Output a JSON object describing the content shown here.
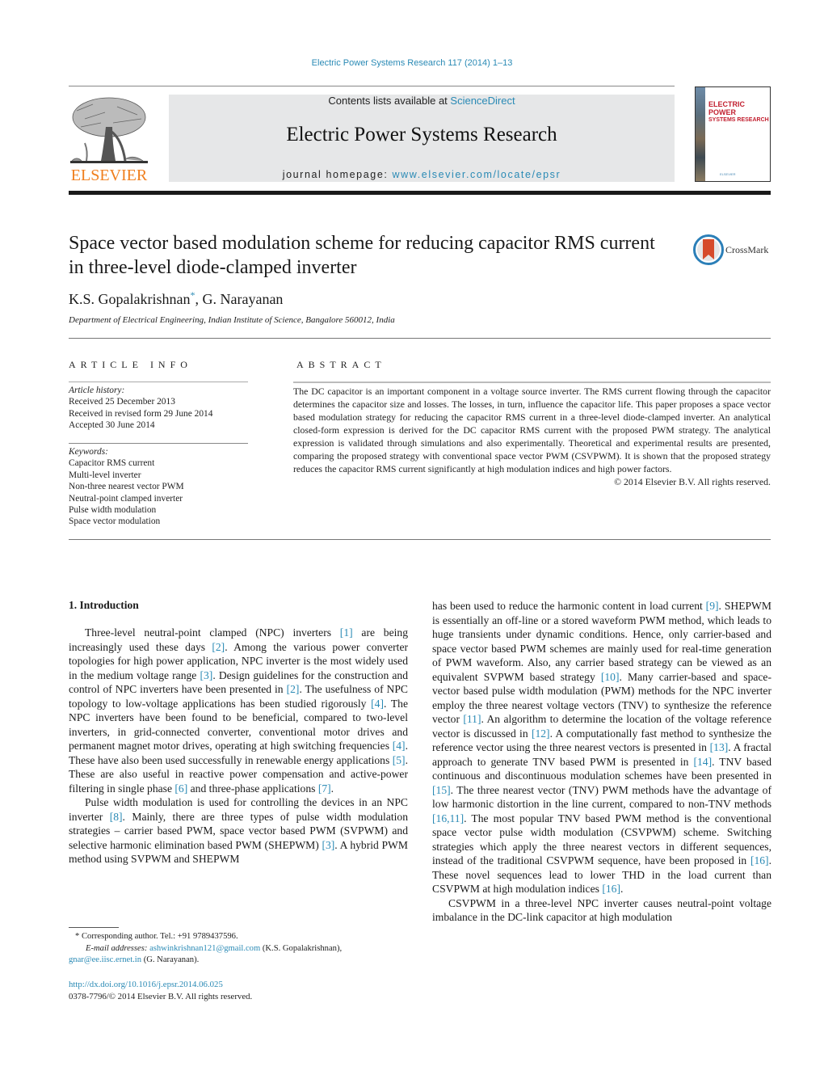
{
  "header": {
    "journal_ref": "Electric Power Systems Research 117 (2014) 1–13",
    "contents_prefix": "Contents lists available at ",
    "contents_link": "ScienceDirect",
    "journal_title": "Electric Power Systems Research",
    "homepage_prefix": "journal homepage: ",
    "homepage_link": "www.elsevier.com/locate/epsr",
    "publisher_wordmark": "ELSEVIER",
    "cover_title_line1": "ELECTRIC POWER",
    "cover_title_line2": "SYSTEMS RESEARCH",
    "cover_publisher": "ELSEVIER",
    "crossmark_label": "CrossMark",
    "colors": {
      "link": "#2a8ab5",
      "elsevier_orange": "#f07f1e",
      "cover_red": "#c21f2f",
      "masthead_bg": "#e6e7e8"
    }
  },
  "article": {
    "title": "Space vector based modulation scheme for reducing capacitor RMS current in three-level diode-clamped inverter",
    "authors": [
      {
        "name": "K.S. Gopalakrishnan",
        "mark": "*"
      },
      {
        "name": "G. Narayanan",
        "mark": ""
      }
    ],
    "author_separator": ", ",
    "affiliation": "Department of Electrical Engineering, Indian Institute of Science, Bangalore 560012, India"
  },
  "article_info": {
    "heading": "ARTICLE INFO",
    "history_label": "Article history:",
    "history": [
      "Received 25 December 2013",
      "Received in revised form 29 June 2014",
      "Accepted 30 June 2014"
    ],
    "keywords_label": "Keywords:",
    "keywords": [
      "Capacitor RMS current",
      "Multi-level inverter",
      "Non-three nearest vector PWM",
      "Neutral-point clamped inverter",
      "Pulse width modulation",
      "Space vector modulation"
    ]
  },
  "abstract": {
    "heading": "ABSTRACT",
    "text": "The DC capacitor is an important component in a voltage source inverter. The RMS current flowing through the capacitor determines the capacitor size and losses. The losses, in turn, influence the capacitor life. This paper proposes a space vector based modulation strategy for reducing the capacitor RMS current in a three-level diode-clamped inverter. An analytical closed-form expression is derived for the DC capacitor RMS current with the proposed PWM strategy. The analytical expression is validated through simulations and also experimentally. Theoretical and experimental results are presented, comparing the proposed strategy with conventional space vector PWM (CSVPWM). It is shown that the proposed strategy reduces the capacitor RMS current significantly at high modulation indices and high power factors.",
    "copyright": "© 2014 Elsevier B.V. All rights reserved."
  },
  "body": {
    "section_heading": "1.  Introduction",
    "p1": [
      {
        "t": "Three-level neutral-point clamped (NPC) inverters "
      },
      {
        "r": "[1]"
      },
      {
        "t": " are being increasingly used these days "
      },
      {
        "r": "[2]"
      },
      {
        "t": ". Among the various power converter topologies for high power application, NPC inverter is the most widely used in the medium voltage range "
      },
      {
        "r": "[3]"
      },
      {
        "t": ". Design guidelines for the construction and control of NPC inverters have been presented in "
      },
      {
        "r": "[2]"
      },
      {
        "t": ". The usefulness of NPC topology to low-voltage applications has been studied rigorously "
      },
      {
        "r": "[4]"
      },
      {
        "t": ". The NPC inverters have been found to be beneficial, compared to two-level inverters, in grid-connected converter, conventional motor drives and permanent magnet motor drives, operating at high switching frequencies "
      },
      {
        "r": "[4]"
      },
      {
        "t": ". These have also been used successfully in renewable energy applications "
      },
      {
        "r": "[5]"
      },
      {
        "t": ". These are also useful in reactive power compensation and active-power filtering in single phase "
      },
      {
        "r": "[6]"
      },
      {
        "t": " and three-phase applications "
      },
      {
        "r": "[7]"
      },
      {
        "t": "."
      }
    ],
    "p2": [
      {
        "t": "Pulse width modulation is used for controlling the devices in an NPC inverter "
      },
      {
        "r": "[8]"
      },
      {
        "t": ". Mainly, there are three types of pulse width modulation strategies – carrier based PWM, space vector based PWM (SVPWM) and selective harmonic elimination based PWM (SHEPWM) "
      },
      {
        "r": "[3]"
      },
      {
        "t": ". A hybrid PWM method using SVPWM and SHEPWM has been used to reduce the harmonic content in load current "
      },
      {
        "r": "[9]"
      },
      {
        "t": ". SHEPWM is essentially an off-line or a stored waveform PWM method, which leads to huge transients under dynamic conditions. Hence, only carrier-based and space vector based PWM schemes are mainly used for real-time generation of PWM waveform. Also, any carrier based strategy can be viewed as an equivalent SVPWM based strategy "
      },
      {
        "r": "[10]"
      },
      {
        "t": ". Many carrier-based and space-vector based pulse width modulation (PWM) methods for the NPC inverter employ the three nearest voltage vectors (TNV) to synthesize the reference vector "
      },
      {
        "r": "[11]"
      },
      {
        "t": ". An algorithm to determine the location of the voltage reference vector is discussed in "
      },
      {
        "r": "[12]"
      },
      {
        "t": ". A computationally fast method to synthesize the reference vector using the three nearest vectors is presented in "
      },
      {
        "r": "[13]"
      },
      {
        "t": ". A fractal approach to generate TNV based PWM is presented in "
      },
      {
        "r": "[14]"
      },
      {
        "t": ". TNV based continuous and discontinuous modulation schemes have been presented in "
      },
      {
        "r": "[15]"
      },
      {
        "t": ". The three nearest vector (TNV) PWM methods have the advantage of low harmonic distortion in the line current, compared to non-TNV methods "
      },
      {
        "r": "[16,11]"
      },
      {
        "t": ". The most popular TNV based PWM method is the conventional space vector pulse width modulation (CSVPWM) scheme. Switching strategies which apply the three nearest vectors in different sequences, instead of the traditional CSVPWM sequence, have been proposed in "
      },
      {
        "r": "[16]"
      },
      {
        "t": ". These novel sequences lead to lower THD in the load current than CSVPWM at high modulation indices "
      },
      {
        "r": "[16]"
      },
      {
        "t": "."
      }
    ],
    "p3": [
      {
        "t": "CSVPWM in a three-level NPC inverter causes neutral-point voltage imbalance in the DC-link capacitor at high modulation"
      }
    ]
  },
  "footnote": {
    "star": "*",
    "corresponding": "Corresponding author. Tel.: +91 9789437596.",
    "email_label": "E-mail addresses:",
    "email1": "ashwinkrishnan121@gmail.com",
    "email1_owner": " (K.S. Gopalakrishnan),",
    "email2": "gnar@ee.iisc.ernet.in",
    "email2_owner": " (G. Narayanan).",
    "doi": "http://dx.doi.org/10.1016/j.epsr.2014.06.025",
    "issn_line": "0378-7796/© 2014 Elsevier B.V. All rights reserved."
  }
}
